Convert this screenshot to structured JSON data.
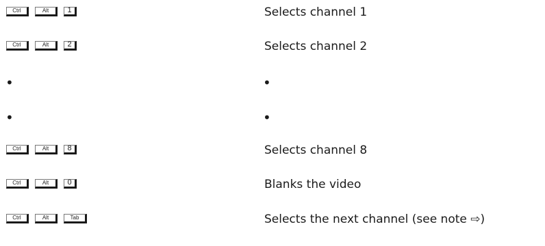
{
  "shortcuts": [
    {
      "keys": [
        "Ctrl",
        "Alt",
        "1"
      ],
      "description": "Selects channel 1"
    },
    {
      "keys": [
        "Ctrl",
        "Alt",
        "2"
      ],
      "description": "Selects channel 2"
    },
    {
      "bullet_left": "•",
      "bullet_right": "•"
    },
    {
      "bullet_left": "•",
      "bullet_right": "•"
    },
    {
      "keys": [
        "Ctrl",
        "Alt",
        "8"
      ],
      "description": "Selects channel 8"
    },
    {
      "keys": [
        "Ctrl",
        "Alt",
        "0"
      ],
      "description": "Blanks the video"
    },
    {
      "keys": [
        "Ctrl",
        "Alt",
        "Tab"
      ],
      "description": "Selects the next channel (see note ⇨)"
    }
  ]
}
